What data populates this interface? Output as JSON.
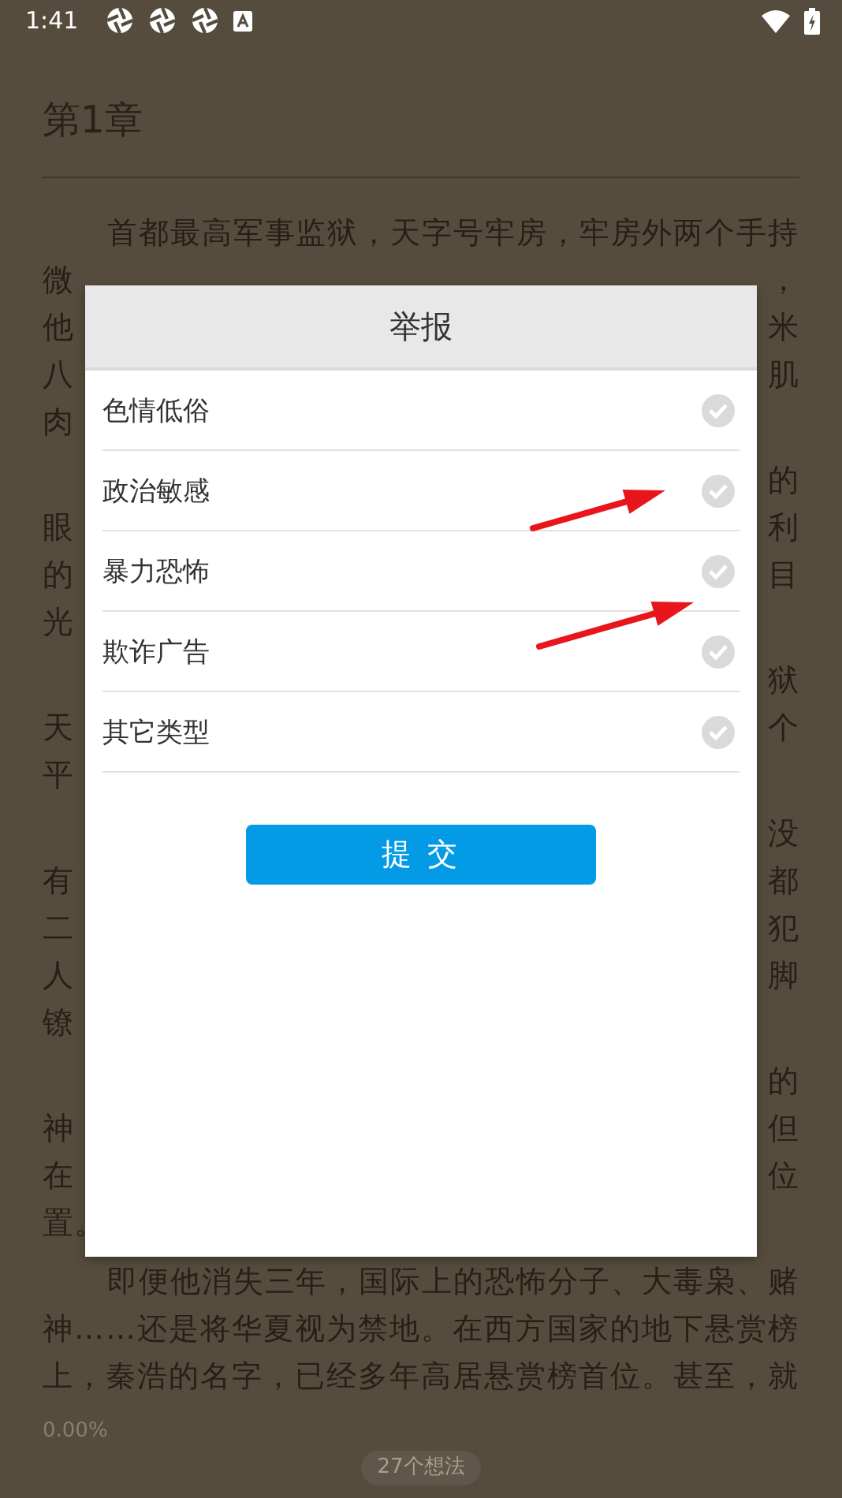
{
  "status_bar": {
    "time": "1:41"
  },
  "reader": {
    "chapter_title": "第1章",
    "paragraphs": [
      {
        "lines": [
          {
            "text": "首都最高军事监狱，天字号牢房，牢房外两个手持"
          },
          {
            "left": "微",
            "right": "，"
          },
          {
            "left": "他",
            "right": "米"
          },
          {
            "left": "八",
            "right": "肌"
          },
          {
            "left": "肉"
          }
        ]
      },
      {
        "lines": [
          {
            "right": "的"
          },
          {
            "left": "眼",
            "right": "利"
          },
          {
            "left": "的",
            "right": "目"
          },
          {
            "left": "光"
          }
        ]
      },
      {
        "lines": [
          {
            "right": "狱"
          },
          {
            "left": "天",
            "right": "个"
          },
          {
            "left": "平"
          }
        ]
      },
      {
        "lines": [
          {
            "right": "没"
          },
          {
            "left": "有",
            "right": "都"
          },
          {
            "left": "二",
            "right": "犯"
          },
          {
            "left": "人",
            "right": "脚"
          },
          {
            "left": "镣"
          }
        ]
      },
      {
        "lines": [
          {
            "right": "的"
          },
          {
            "left": "神",
            "right": "但"
          },
          {
            "left": "在",
            "right": "位"
          },
          {
            "left": "置。"
          }
        ]
      },
      {
        "lines": [
          {
            "text": "即便他消失三年，国际上的恐怖分子、大毒枭、赌"
          },
          {
            "text": "神……还是将华夏视为禁地。在西方国家的地下悬赏榜"
          },
          {
            "text": "上，秦浩的名字，已经多年高居悬赏榜首位。甚至，就"
          }
        ]
      }
    ],
    "progress": "0.00%",
    "thoughts": "27个想法"
  },
  "dialog": {
    "title": "举报",
    "options": [
      {
        "label": "色情低俗",
        "selected": false
      },
      {
        "label": "政治敏感",
        "selected": false
      },
      {
        "label": "暴力恐怖",
        "selected": false
      },
      {
        "label": "欺诈广告",
        "selected": false
      },
      {
        "label": "其它类型",
        "selected": false
      }
    ],
    "submit": "提 交"
  },
  "annotations": [
    {
      "kind": "arrow"
    },
    {
      "kind": "arrow"
    }
  ]
}
